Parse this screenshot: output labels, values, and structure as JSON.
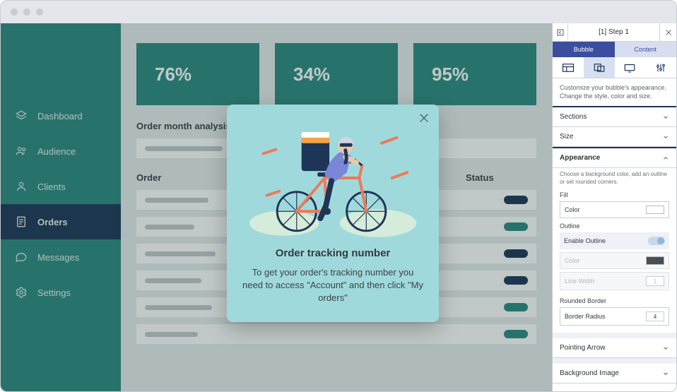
{
  "sidebar": {
    "items": [
      {
        "label": "Dashboard",
        "icon": "layers-icon"
      },
      {
        "label": "Audience",
        "icon": "users-icon"
      },
      {
        "label": "Clients",
        "icon": "user-icon"
      },
      {
        "label": "Orders",
        "icon": "document-icon"
      },
      {
        "label": "Messages",
        "icon": "chat-icon"
      },
      {
        "label": "Settings",
        "icon": "gear-icon"
      }
    ],
    "activeIndex": 3
  },
  "stats": [
    {
      "value": "76%"
    },
    {
      "value": "34%"
    },
    {
      "value": "95%"
    }
  ],
  "sectionTitle": "Order month analysis",
  "tableHeaders": {
    "order": "Order",
    "status": "Status"
  },
  "modal": {
    "title": "Order tracking number",
    "body": "To get your order's tracking number you need to access \"Account\" and then click \"My orders\""
  },
  "panel": {
    "stepTitle": "[1] Step 1",
    "tabs": {
      "bubble": "Bubble",
      "content": "Content"
    },
    "iconTabs": [
      "layout-icon",
      "appearance-icon",
      "display-icon",
      "sliders-icon"
    ],
    "activeIconTab": 1,
    "description": "Customize your bubble's appearance. Change the style, color and size.",
    "accordions": {
      "sections": "Sections",
      "size": "Size",
      "appearance": "Appearance",
      "pointingArrow": "Pointing Arrow",
      "backgroundImage": "Background Image"
    },
    "appearance": {
      "desc": "Choose a background color, add an outline or set rounded corners.",
      "fillLabel": "Fill",
      "colorLabel": "Color",
      "outlineLabel": "Outline",
      "enableOutline": "Enable Outline",
      "outlineColor": "Color",
      "lineWidth": "Line Width",
      "lineWidthValue": "1",
      "roundedLabel": "Rounded Border",
      "borderRadius": "Border Radius",
      "borderRadiusValue": "4"
    }
  }
}
